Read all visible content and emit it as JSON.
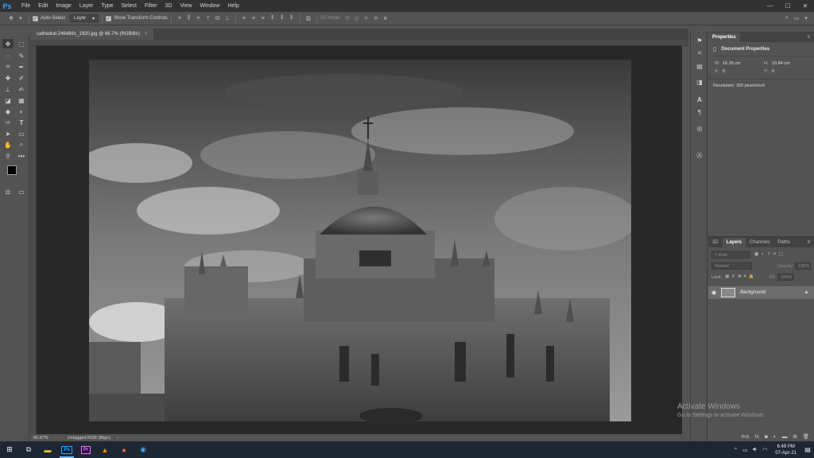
{
  "app": {
    "logo": "Ps"
  },
  "menu": [
    "File",
    "Edit",
    "Image",
    "Layer",
    "Type",
    "Select",
    "Filter",
    "3D",
    "View",
    "Window",
    "Help"
  ],
  "window_controls": {
    "minimize": "—",
    "maximize": "☐",
    "close": "✕"
  },
  "options": {
    "auto_select_label": "Auto-Select",
    "auto_select_target": "Layer",
    "show_transform_label": "Show Transform Controls",
    "mode_3d_label": "3D Mode:"
  },
  "document": {
    "tab_title": "cathedral-2464891_1920.jpg @ 66.7% (RGB/8#)",
    "tab_close": "×",
    "zoom": "66.67%",
    "profile": "Untagged RGB (8bpc)",
    "status_arrow": "›"
  },
  "properties": {
    "tab": "Properties",
    "section": "Document Properties",
    "w_label": "W:",
    "w_value": "16.26 cm",
    "h_label": "H:",
    "h_value": "10.84 cm",
    "x_label": "X:",
    "x_value": "0",
    "y_label": "Y:",
    "y_value": "0",
    "resolution": "Resolution: 300 pixels/inch"
  },
  "layers": {
    "tabs": [
      "3D",
      "Layers",
      "Channels",
      "Paths"
    ],
    "active_tab": "Layers",
    "kind_placeholder": "Kind",
    "blend_mode": "Normal",
    "opacity_label": "Opacity:",
    "opacity_value": "100%",
    "lock_label": "Lock:",
    "fill_label": "Fill:",
    "fill_value": "100%",
    "layer_name": "Background"
  },
  "watermark": {
    "title": "Activate Windows",
    "subtitle": "Go to Settings to activate Windows."
  },
  "taskbar": {
    "time": "6:49 PM",
    "date": "07-Apr-21"
  },
  "colors": {
    "menubar": "#323232",
    "panel": "#535353",
    "canvas_bg": "#282828",
    "taskbar": "#1f2633",
    "ps_blue": "#31a8ff",
    "layer_selected": "#6d6d6d"
  }
}
